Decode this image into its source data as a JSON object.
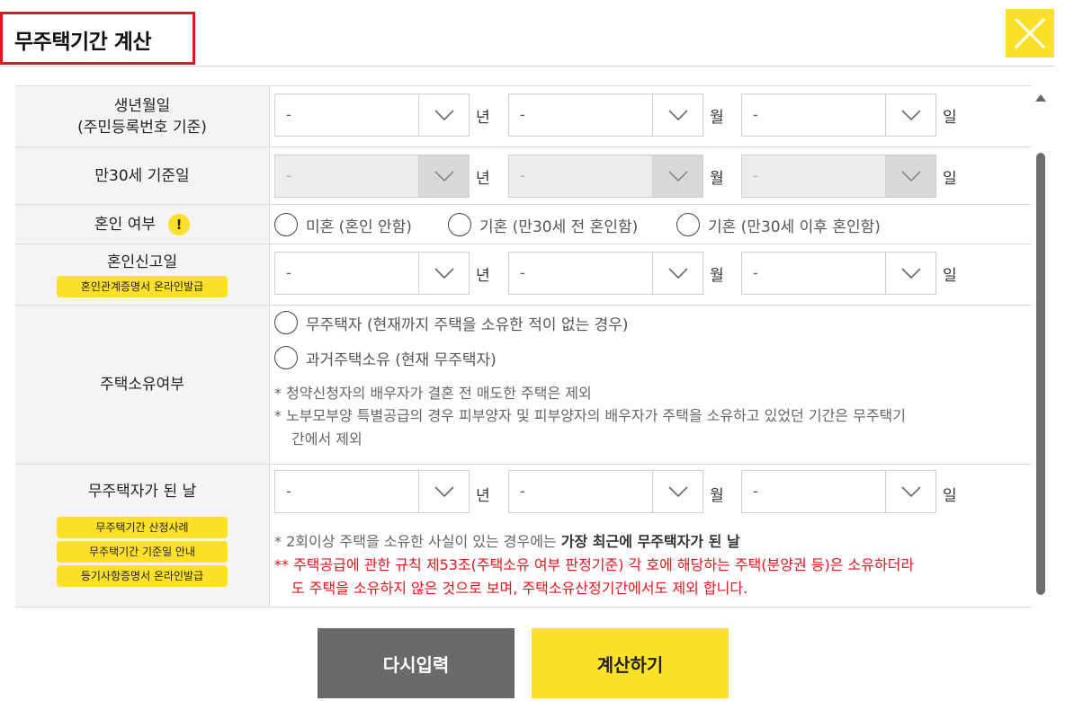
{
  "dialog": {
    "title": "무주택기간 계산",
    "close_icon": "close-icon"
  },
  "rows": {
    "birth": {
      "label1": "생년월일",
      "label2": "(주민등록번호 기준)",
      "year": "-",
      "month": "-",
      "day": "-"
    },
    "age30": {
      "label": "만30세 기준일",
      "year": "-",
      "month": "-",
      "day": "-"
    },
    "marriage": {
      "label": "혼인 여부",
      "options": [
        "미혼 (혼인 안함)",
        "기혼 (만30세 전 혼인함)",
        "기혼 (만30세 이후 혼인함)"
      ]
    },
    "marriage_report": {
      "label": "혼인신고일",
      "link": "혼인관계증명서 온라인발급",
      "year": "-",
      "month": "-",
      "day": "-"
    },
    "ownership": {
      "label": "주택소유여부",
      "options": [
        "무주택자 (현재까지 주택을 소유한 적이 없는 경우)",
        "과거주택소유 (현재 무주택자)"
      ],
      "note1": "* 청약신청자의 배우자가 결혼 전 매도한 주택은 제외",
      "note2a": "* 노부모부양 특별공급의 경우 피부양자 및 피부양자의 배우자가 주택을 소유하고 있었던 기간은 무주택기",
      "note2b": "간에서 제외"
    },
    "homeless_date": {
      "label": "무주택자가 된 날",
      "links": [
        "무주택기간 산정사례",
        "무주택기간 기준일 안내",
        "등기사항증명서 온라인발급"
      ],
      "year": "-",
      "month": "-",
      "day": "-",
      "note1_pre": "* 2회이상 주택을 소유한 사실이 있는 경우에는 ",
      "note1_bold": "가장 최근에 무주택자가 된 날",
      "note2a": "** 주택공급에 관한 규칙 제53조(주택소유 여부 판정기준) 각 호에 해당하는 주택(분양권 등)은 소유하더라",
      "note2b": "도 주택을 소유하지 않은 것으로 보며, 주택소유산정기간에서도 제외 합니다."
    }
  },
  "units": {
    "year": "년",
    "month": "월",
    "day": "일"
  },
  "buttons": {
    "reset": "다시입력",
    "calc": "계산하기"
  },
  "colors": {
    "accent": "#fde02a",
    "alert": "#e4161d",
    "reset_bg": "#6a6a6a"
  }
}
